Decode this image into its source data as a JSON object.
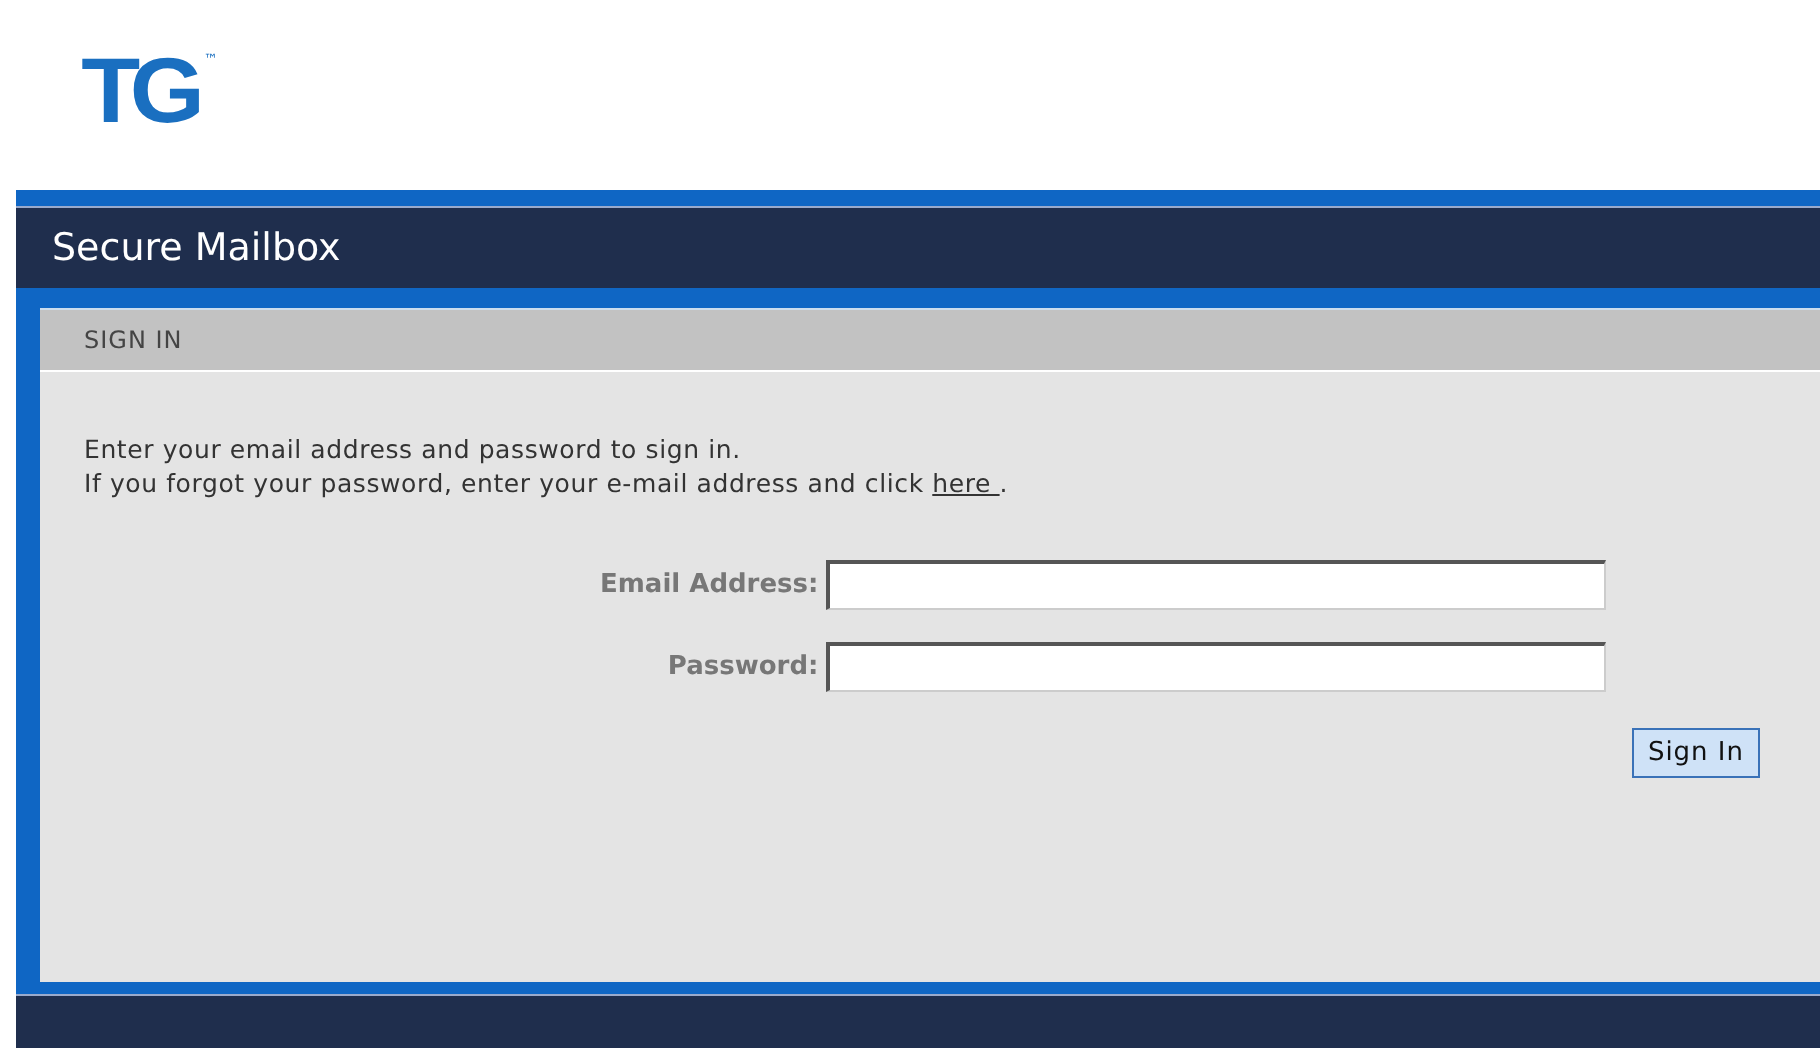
{
  "logo": {
    "text": "TG",
    "mark": "™"
  },
  "header": {
    "title": "Secure Mailbox"
  },
  "panel": {
    "title": "SIGN IN",
    "intro": {
      "line_1": "Enter your email address and password to sign in.",
      "line_2": "If you forgot your password, enter your e-mail address and click",
      "link": "here ",
      "line_2_end": "."
    },
    "fields": [
      {
        "label": "Email Address:"
      },
      {
        "label": "Password:"
      }
    ],
    "button": "Sign In"
  }
}
